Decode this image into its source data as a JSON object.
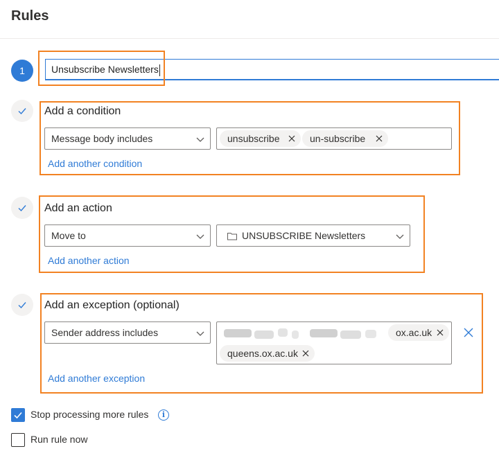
{
  "header": {
    "title": "Rules"
  },
  "rule_name": {
    "step": "1",
    "value": "Unsubscribe Newsletters"
  },
  "condition": {
    "label": "Add a condition",
    "type_value": "Message body includes",
    "chips": [
      "unsubscribe",
      "un-subscribe"
    ],
    "add_link": "Add another condition"
  },
  "action": {
    "label": "Add an action",
    "type_value": "Move to",
    "folder_value": "UNSUBSCRIBE Newsletters",
    "add_link": "Add another action"
  },
  "exception": {
    "label": "Add an exception (optional)",
    "type_value": "Sender address includes",
    "chips": [
      "ox.ac.uk",
      "queens.ox.ac.uk"
    ],
    "add_link": "Add another exception"
  },
  "options": {
    "stop_processing": {
      "label": "Stop processing more rules",
      "checked": true
    },
    "run_now": {
      "label": "Run rule now",
      "checked": false
    }
  },
  "colors": {
    "accent": "#2f7bd6",
    "highlight": "#f28222"
  }
}
